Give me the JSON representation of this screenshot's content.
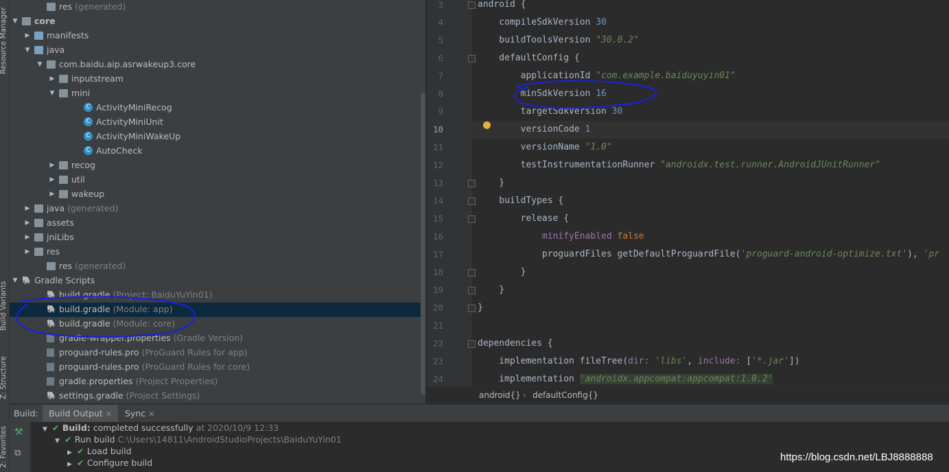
{
  "tool_strip": {
    "resource_manager": "Resource Manager",
    "build_variants": "Build Variants",
    "structure": "Z: Structure",
    "favorites": "2: Favorites"
  },
  "tree": [
    {
      "label": "res",
      "suffix": "(generated)",
      "indent": 38,
      "arrow": "",
      "icon": "folder"
    },
    {
      "label": "core",
      "suffix": "",
      "indent": 2,
      "arrow": "down",
      "icon": "folder",
      "bold": true
    },
    {
      "label": "manifests",
      "suffix": "",
      "indent": 20,
      "arrow": "right",
      "icon": "folder-blue"
    },
    {
      "label": "java",
      "suffix": "",
      "indent": 20,
      "arrow": "down",
      "icon": "folder-blue"
    },
    {
      "label": "com.baidu.aip.asrwakeup3.core",
      "suffix": "",
      "indent": 38,
      "arrow": "down",
      "icon": "folder"
    },
    {
      "label": "inputstream",
      "suffix": "",
      "indent": 56,
      "arrow": "right",
      "icon": "folder"
    },
    {
      "label": "mini",
      "suffix": "",
      "indent": 56,
      "arrow": "down",
      "icon": "folder"
    },
    {
      "label": "ActivityMiniRecog",
      "suffix": "",
      "indent": 92,
      "arrow": "",
      "icon": "class"
    },
    {
      "label": "ActivityMiniUnit",
      "suffix": "",
      "indent": 92,
      "arrow": "",
      "icon": "class"
    },
    {
      "label": "ActivityMiniWakeUp",
      "suffix": "",
      "indent": 92,
      "arrow": "",
      "icon": "class"
    },
    {
      "label": "AutoCheck",
      "suffix": "",
      "indent": 92,
      "arrow": "",
      "icon": "class"
    },
    {
      "label": "recog",
      "suffix": "",
      "indent": 56,
      "arrow": "right",
      "icon": "folder"
    },
    {
      "label": "util",
      "suffix": "",
      "indent": 56,
      "arrow": "right",
      "icon": "folder"
    },
    {
      "label": "wakeup",
      "suffix": "",
      "indent": 56,
      "arrow": "right",
      "icon": "folder"
    },
    {
      "label": "java",
      "suffix": "(generated)",
      "indent": 20,
      "arrow": "right",
      "icon": "folder"
    },
    {
      "label": "assets",
      "suffix": "",
      "indent": 20,
      "arrow": "right",
      "icon": "folder"
    },
    {
      "label": "jniLibs",
      "suffix": "",
      "indent": 20,
      "arrow": "right",
      "icon": "folder"
    },
    {
      "label": "res",
      "suffix": "",
      "indent": 20,
      "arrow": "right",
      "icon": "folder"
    },
    {
      "label": "res",
      "suffix": "(generated)",
      "indent": 38,
      "arrow": "",
      "icon": "folder"
    },
    {
      "label": "Gradle Scripts",
      "suffix": "",
      "indent": 2,
      "arrow": "down",
      "icon": "gradle"
    },
    {
      "label": "build.gradle",
      "suffix": "(Project: BaiduYuYin01)",
      "indent": 38,
      "arrow": "",
      "icon": "gradle"
    },
    {
      "label": "build.gradle",
      "suffix": "(Module: app)",
      "indent": 38,
      "arrow": "",
      "icon": "gradle",
      "selected": true
    },
    {
      "label": "build.gradle",
      "suffix": "(Module: core)",
      "indent": 38,
      "arrow": "",
      "icon": "gradle"
    },
    {
      "label": "gradle-wrapper.properties",
      "suffix": "(Gradle Version)",
      "indent": 38,
      "arrow": "",
      "icon": "props"
    },
    {
      "label": "proguard-rules.pro",
      "suffix": "(ProGuard Rules for app)",
      "indent": 38,
      "arrow": "",
      "icon": "props"
    },
    {
      "label": "proguard-rules.pro",
      "suffix": "(ProGuard Rules for core)",
      "indent": 38,
      "arrow": "",
      "icon": "props"
    },
    {
      "label": "gradle.properties",
      "suffix": "(Project Properties)",
      "indent": 38,
      "arrow": "",
      "icon": "props"
    },
    {
      "label": "settings.gradle",
      "suffix": "(Project Settings)",
      "indent": 38,
      "arrow": "",
      "icon": "gradle"
    }
  ],
  "editor": {
    "line_numbers": [
      "3",
      "4",
      "5",
      "6",
      "7",
      "8",
      "9",
      "10",
      "11",
      "12",
      "13",
      "14",
      "15",
      "16",
      "17",
      "18",
      "19",
      "20",
      "21",
      "22",
      "23",
      "24"
    ],
    "current_line": "10",
    "lines": [
      [
        [
          "t",
          "android {"
        ]
      ],
      [
        [
          "t",
          "    compileSdkVersion "
        ],
        [
          "n",
          "30"
        ]
      ],
      [
        [
          "t",
          "    buildToolsVersion "
        ],
        [
          "s",
          "\"30.0.2\""
        ]
      ],
      [
        [
          "t",
          "    defaultConfig {"
        ]
      ],
      [
        [
          "t",
          "        applicationId "
        ],
        [
          "s",
          "\"com.example.baiduyuyin01\""
        ]
      ],
      [
        [
          "t",
          "        minSdkVersion "
        ],
        [
          "n",
          "16"
        ]
      ],
      [
        [
          "t",
          "        targetSdkVersion "
        ],
        [
          "n",
          "30"
        ]
      ],
      [
        [
          "t",
          "        versionCode "
        ],
        [
          "n",
          "1"
        ]
      ],
      [
        [
          "t",
          "        versionName "
        ],
        [
          "s",
          "\"1.0\""
        ]
      ],
      [
        [
          "t",
          "        testInstrumentationRunner "
        ],
        [
          "s",
          "\"androidx.test.runner.AndroidJUnitRunner\""
        ]
      ],
      [
        [
          "t",
          "    }"
        ]
      ],
      [
        [
          "t",
          "    buildTypes {"
        ]
      ],
      [
        [
          "t",
          "        release {"
        ]
      ],
      [
        [
          "t",
          "            "
        ],
        [
          "p",
          "minifyEnabled "
        ],
        [
          "k",
          "false"
        ]
      ],
      [
        [
          "t",
          "            proguardFiles getDefaultProguardFile("
        ],
        [
          "s",
          "'proguard-android-optimize.txt'"
        ],
        [
          "t",
          "), "
        ],
        [
          "s",
          "'pr"
        ]
      ],
      [
        [
          "t",
          "        }"
        ]
      ],
      [
        [
          "t",
          "    }"
        ]
      ],
      [
        [
          "t",
          "}"
        ]
      ],
      [
        [
          "t",
          ""
        ]
      ],
      [
        [
          "t",
          "dependencies {"
        ]
      ],
      [
        [
          "t",
          "    implementation fileTree("
        ],
        [
          "p",
          "dir: "
        ],
        [
          "s",
          "'libs'"
        ],
        [
          "t",
          ", "
        ],
        [
          "p",
          "include: "
        ],
        [
          "t",
          "["
        ],
        [
          "s",
          "'*.jar'"
        ],
        [
          "t",
          "])"
        ]
      ],
      [
        [
          "t",
          "    implementation "
        ],
        [
          "h",
          "'androidx.appcompat:appcompat:1.0.2'"
        ]
      ]
    ],
    "breadcrumbs": [
      "android{}",
      "defaultConfig{}"
    ]
  },
  "build_panel": {
    "label": "Build:",
    "tabs": [
      "Build Output",
      "Sync"
    ],
    "rows": [
      {
        "indent": 48,
        "arrow": "down",
        "bold": "Build:",
        "text": " completed successfully",
        "dim": " at 2020/10/9 12:33"
      },
      {
        "indent": 66,
        "arrow": "down",
        "bold": "",
        "text": "Run build",
        "dim": " C:\\Users\\14811\\AndroidStudioProjects\\BaiduYuYin01"
      },
      {
        "indent": 84,
        "arrow": "right",
        "bold": "",
        "text": "Load build",
        "dim": ""
      },
      {
        "indent": 84,
        "arrow": "right",
        "bold": "",
        "text": "Configure build",
        "dim": ""
      }
    ]
  },
  "watermark": "https://blog.csdn.net/LBJ8888888",
  "colors": {
    "annotation": "#1a22d6",
    "selection": "#0d293e",
    "success": "#59a869"
  }
}
